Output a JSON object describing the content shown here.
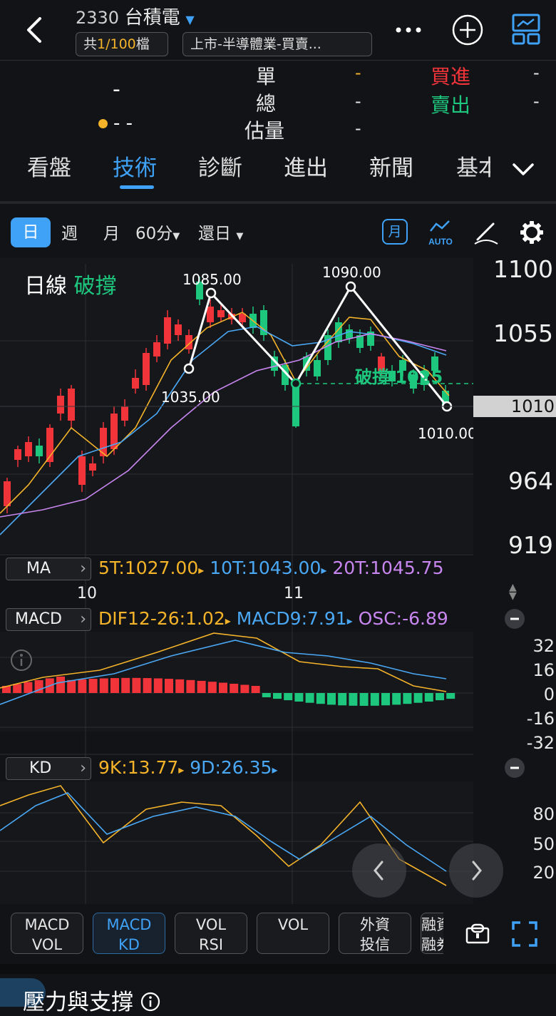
{
  "header": {
    "stock_code": "2330",
    "stock_name": "台積電",
    "count_prefix": "共",
    "count_value": "1/100",
    "count_suffix": "檔",
    "industry": "上市-半導體業-買賣..."
  },
  "quote": {
    "price": "-",
    "change": "- -",
    "single_label": "單",
    "single_value": "-",
    "total_label": "總",
    "total_value": "-",
    "est_label": "估量",
    "est_value": "-",
    "buy_label": "買進",
    "buy_value": "-",
    "sell_label": "賣出",
    "sell_value": "-"
  },
  "tabs": [
    "看盤",
    "技術",
    "診斷",
    "進出",
    "新聞",
    "基本"
  ],
  "intervals": {
    "day": "日",
    "week": "週",
    "month": "月",
    "min60": "60分",
    "restore": "還日",
    "month_icon": "月",
    "auto": "AUTO"
  },
  "main_chart": {
    "title": "日線",
    "signal": "破撐",
    "support_label": "破撐 1025",
    "price_axis": [
      "1100",
      "1055",
      "1010",
      "964",
      "919"
    ],
    "current_price": "1010",
    "annotations": [
      "1085.00",
      "1035.00",
      "1090.00",
      "1010.00"
    ],
    "date_ticks": [
      "10",
      "11"
    ]
  },
  "ma": {
    "label": "MA",
    "ma5": "5T:1027.00",
    "ma10": "10T:1043.00",
    "ma20": "20T:1045.75"
  },
  "macd": {
    "label": "MACD",
    "dif": "DIF12-26:1.02",
    "macd9": "MACD9:7.91",
    "osc": "OSC:-6.89",
    "axis": [
      "32",
      "16",
      "0",
      "-16",
      "-32"
    ]
  },
  "kd": {
    "label": "KD",
    "k": "9K:13.77",
    "d": "9D:26.35",
    "axis": [
      "80",
      "50",
      "20"
    ]
  },
  "bottom_buttons": [
    [
      "MACD",
      "VOL"
    ],
    [
      "MACD",
      "KD"
    ],
    [
      "VOL",
      "RSI"
    ],
    [
      "VOL",
      ""
    ],
    [
      "外資",
      "投信"
    ],
    [
      "融資",
      "融券"
    ]
  ],
  "section_title": "壓力與支撐",
  "colors": {
    "up": "#f0343a",
    "down": "#1ec77e",
    "accent": "#3fa2f7",
    "ma5": "#f5b32a",
    "ma10": "#4aa8f5",
    "ma20": "#c886f0"
  },
  "icons": [
    "back-icon",
    "dropdown-icon",
    "more-icon",
    "add-icon",
    "chart-layout-icon",
    "gear-icon",
    "pen-icon",
    "auto-icon",
    "info-icon",
    "lock-icon",
    "fullscreen-icon"
  ]
}
